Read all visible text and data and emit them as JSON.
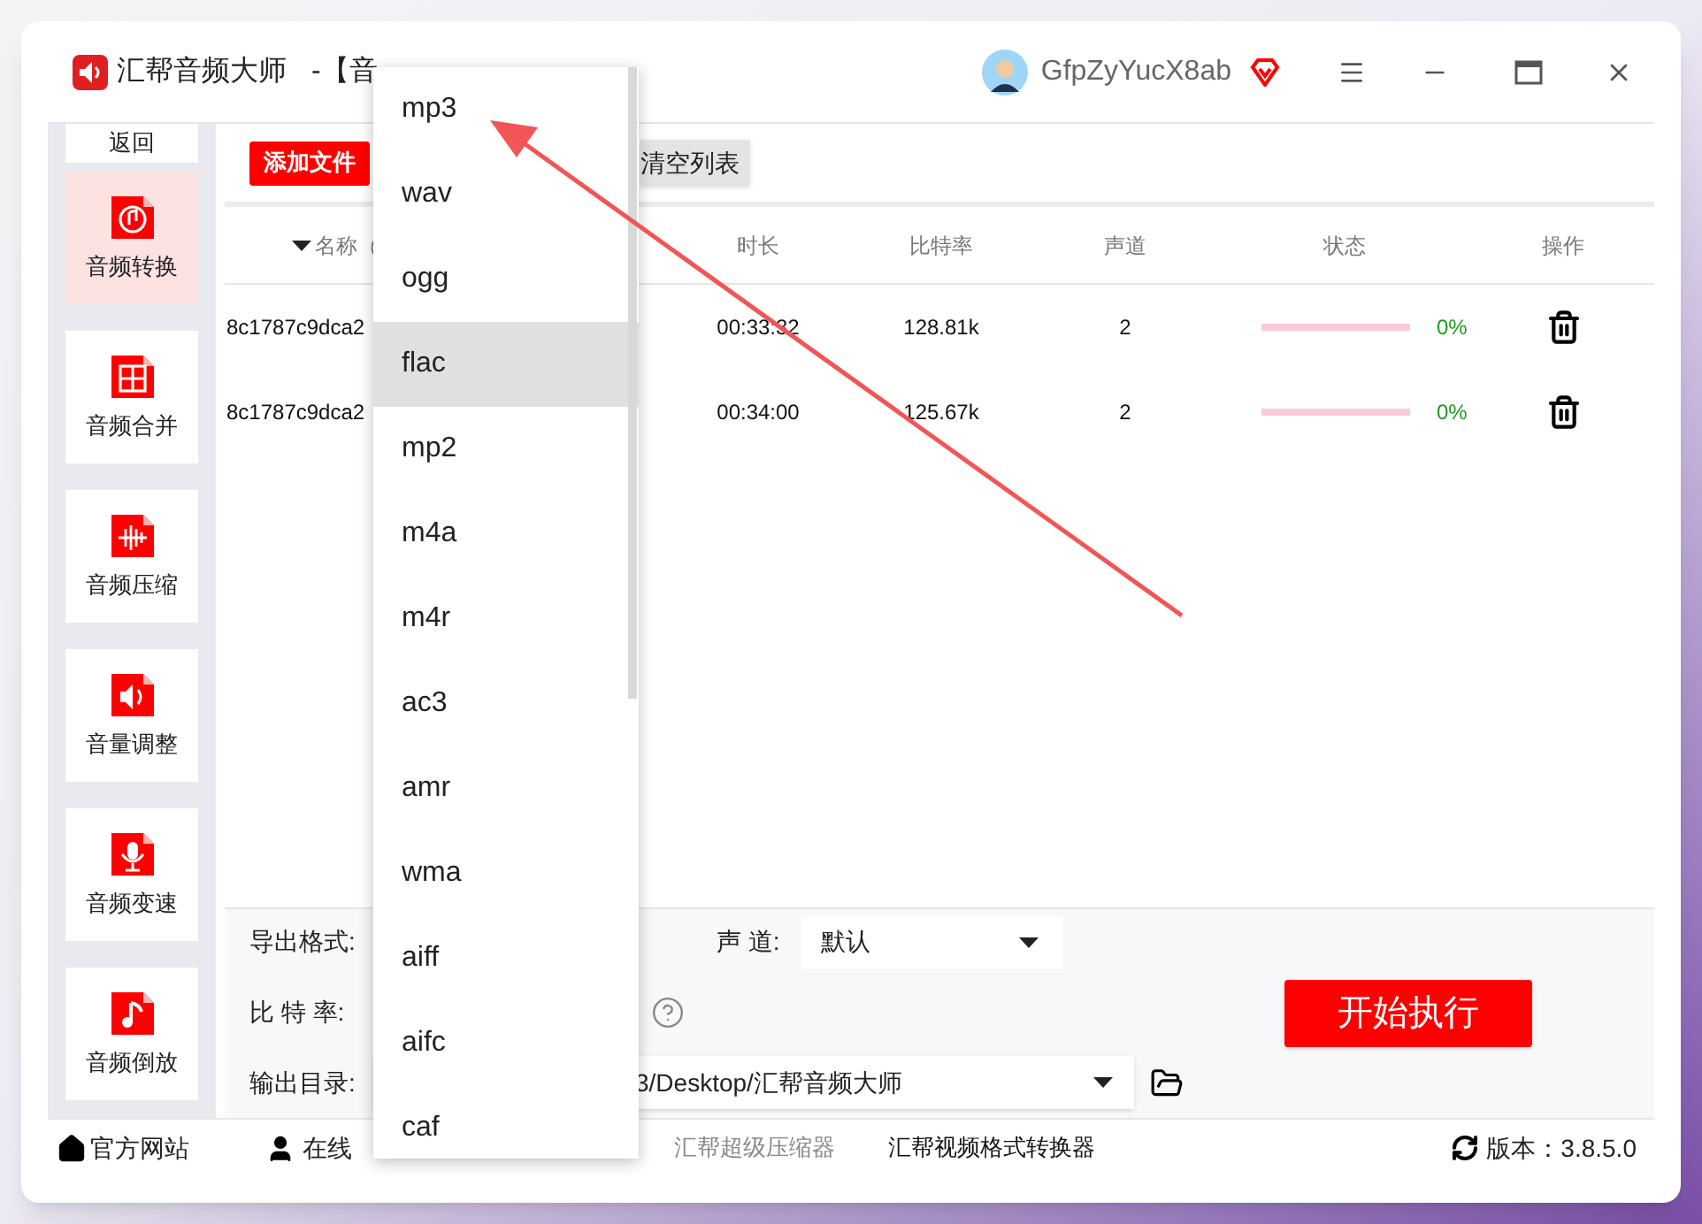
{
  "window": {
    "title": "汇帮音频大师",
    "subtitle": "-【音",
    "user": "GfpZyYucX8ab"
  },
  "sidebar": {
    "back": "返回",
    "items": [
      {
        "label": "音频转换",
        "selected": true
      },
      {
        "label": "音频合并",
        "selected": false
      },
      {
        "label": "音频压缩",
        "selected": false
      },
      {
        "label": "音量调整",
        "selected": false
      },
      {
        "label": "音频变速",
        "selected": false
      },
      {
        "label": "音频倒放",
        "selected": false
      }
    ]
  },
  "toolbar": {
    "add_button": "添加文件",
    "clear_button": "清空列表"
  },
  "table": {
    "columns": [
      "名称（",
      "时长",
      "比特率",
      "声道",
      "状态",
      "操作"
    ],
    "rows": [
      {
        "name": "8c1787c9dca2",
        "duration": "00:33:32",
        "bitrate": "128.81k",
        "channels": "2",
        "level": 0,
        "progress": "0%"
      },
      {
        "name": "8c1787c9dca2",
        "duration": "00:34:00",
        "bitrate": "125.67k",
        "channels": "2",
        "level": 0,
        "progress": "0%"
      }
    ]
  },
  "settings": {
    "format_label": "导出格式:",
    "channel_label": "声 道:",
    "channel_value": "默认",
    "bitrate_label": "比 特 率:",
    "output_label": "输出目录:",
    "output_path": "3/Desktop/汇帮音频大师",
    "start_button": "开始执行"
  },
  "footer": {
    "links": [
      "官方网站",
      "在线"
    ],
    "products": [
      {
        "label": "汇帮超级压缩器",
        "disabled": true
      },
      {
        "label": "汇帮视频格式转换器",
        "disabled": false
      }
    ],
    "version": "版本：3.8.5.0"
  },
  "dropdown": {
    "options": [
      {
        "label": "mp3",
        "selected": false
      },
      {
        "label": "wav",
        "selected": false
      },
      {
        "label": "ogg",
        "selected": false
      },
      {
        "label": "flac",
        "selected": true
      },
      {
        "label": "mp2",
        "selected": false
      },
      {
        "label": "m4a",
        "selected": false
      },
      {
        "label": "m4r",
        "selected": false
      },
      {
        "label": "ac3",
        "selected": false
      },
      {
        "label": "amr",
        "selected": false
      },
      {
        "label": "wma",
        "selected": false
      },
      {
        "label": "aiff",
        "selected": false
      },
      {
        "label": "aifc",
        "selected": false
      },
      {
        "label": "caf",
        "selected": false
      }
    ]
  }
}
